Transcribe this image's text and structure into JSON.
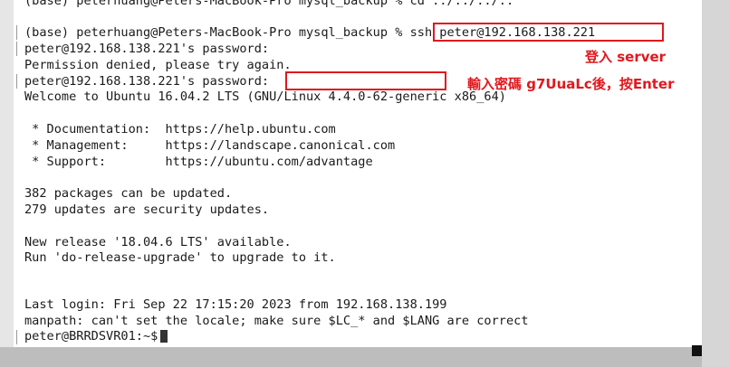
{
  "terminal": {
    "top_partial": "(base) peterhuang@Peters-MacBook-Pro mysql_backup % cd ../../../..",
    "lines": [
      "(base) peterhuang@Peters-MacBook-Pro mysql_backup % ssh peter@192.168.138.221",
      "peter@192.168.138.221's password:",
      "Permission denied, please try again.",
      "peter@192.168.138.221's password:",
      "Welcome to Ubuntu 16.04.2 LTS (GNU/Linux 4.4.0-62-generic x86_64)",
      "",
      " * Documentation:  https://help.ubuntu.com",
      " * Management:     https://landscape.canonical.com",
      " * Support:        https://ubuntu.com/advantage",
      "",
      "382 packages can be updated.",
      "279 updates are security updates.",
      "",
      "New release '18.04.6 LTS' available.",
      "Run 'do-release-upgrade' to upgrade to it.",
      "",
      "",
      "Last login: Fri Sep 22 17:15:20 2023 from 192.168.138.199",
      "manpath: can't set the locale; make sure $LC_* and $LANG are correct",
      "peter@BRRDSVR01:~$"
    ]
  },
  "annotations": {
    "login_label": "登入 server",
    "password_label": "輸入密碼 g7UuaLc後，按Enter"
  },
  "colors": {
    "annotation_red": "#e0181e",
    "terminal_bg": "#ffffff",
    "terminal_text": "#1a1a1a"
  }
}
